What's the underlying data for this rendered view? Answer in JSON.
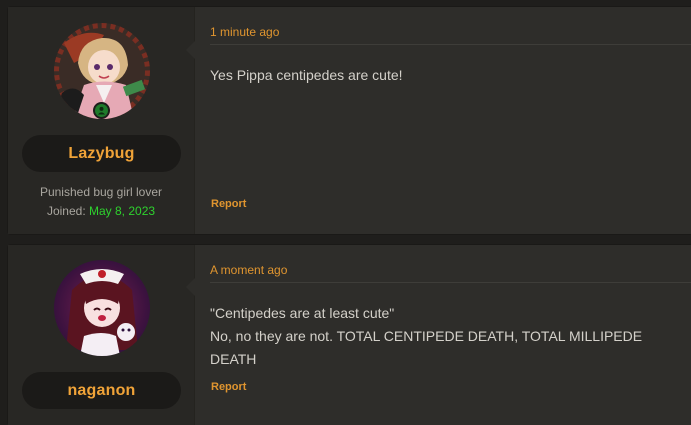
{
  "posts": [
    {
      "author": "Lazybug",
      "user_title": "Punished bug girl lover",
      "joined_label": "Joined:",
      "joined_date": "May 8, 2023",
      "online": true,
      "timestamp": "1 minute ago",
      "message_lines": [
        "Yes Pippa centipedes are cute!"
      ],
      "report_label": "Report"
    },
    {
      "author": "naganon",
      "timestamp": "A moment ago",
      "message_lines": [
        "\"Centipedes are at least cute\"",
        "No, no they are not. TOTAL CENTIPEDE DEATH, TOTAL MILLIPEDE DEATH"
      ],
      "report_label": "Report"
    }
  ],
  "colors": {
    "accent": "#e0952f",
    "username": "#f0a338",
    "joined_date": "#2ed12e",
    "online": "#1f7a2a",
    "background": "#1f1e1c"
  }
}
